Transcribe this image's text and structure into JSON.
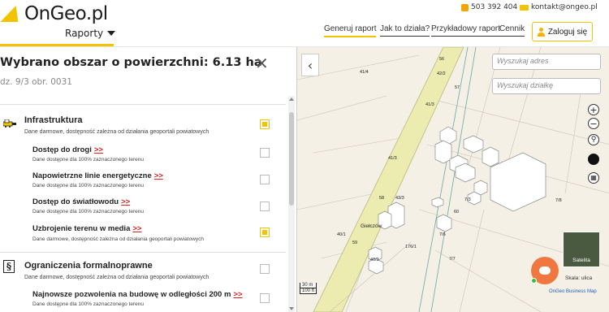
{
  "header": {
    "logo_text": "OnGeo.pl",
    "reports_menu": "Raporty",
    "phone": "503 392 404",
    "email": "kontakt@ongeo.pl",
    "nav": {
      "generate": "Generuj raport",
      "how": "Jak to działa?",
      "sample": "Przykładowy raport",
      "pricing": "Cennik"
    },
    "login_label": "Zaloguj się"
  },
  "panel": {
    "title": "Wybrano obszar o powierzchni: 6.13 ha",
    "subtitle": "dz. 9/3 obr. 0031",
    "sections": [
      {
        "title": "Infrastruktura",
        "desc": "Dane darmowe, dostępność zależna od działania geoportali powiatowych",
        "checked": true,
        "items": [
          {
            "title": "Dostęp do drogi",
            "link": ">>",
            "desc": "Dane dostępne dla 100% zaznaczonego terenu",
            "checked": false
          },
          {
            "title": "Napowietrzne linie energetyczne",
            "link": ">>",
            "desc": "Dane dostępne dla 100% zaznaczonego terenu",
            "checked": false
          },
          {
            "title": "Dostęp do światłowodu",
            "link": ">>",
            "desc": "Dane dostępne dla 100% zaznaczonego terenu",
            "checked": false
          },
          {
            "title": "Uzbrojenie terenu w media",
            "link": ">>",
            "desc": "Dane darmowe, dostępność zależna od działania geoportali powiatowych",
            "checked": true
          }
        ]
      },
      {
        "title": "Ograniczenia formalnoprawne",
        "desc": "Dane darmowe, dostępność zależna od działania geoportali powiatowych",
        "checked": false,
        "items": [
          {
            "title": "Najnowsze pozwolenia na budowę w odległości 200 m",
            "link": ">>",
            "desc": "Dane dostępne dla 100% zaznaczonego terenu",
            "checked": false
          }
        ]
      }
    ]
  },
  "map": {
    "address_placeholder": "Wyszukaj adres",
    "parcel_placeholder": "Wyszukaj działkę",
    "satellite_label": "Satelita",
    "scale_label": "Skala: ulica",
    "attribution": "OnGeo Business Map",
    "scale_m": "30 m",
    "scale_ft": "100 ft",
    "place_name": "Giełczów",
    "parcels": [
      "56",
      "42/2",
      "57",
      "41/4",
      "41/3",
      "41/3",
      "58",
      "43/3",
      "7/3",
      "60",
      "7/8",
      "40/1",
      "59",
      "176/1",
      "7/6",
      "7/7",
      "40/3"
    ]
  },
  "colors": {
    "accent": "#f2c400",
    "link_red": "#d62020",
    "chat": "#f07840"
  }
}
